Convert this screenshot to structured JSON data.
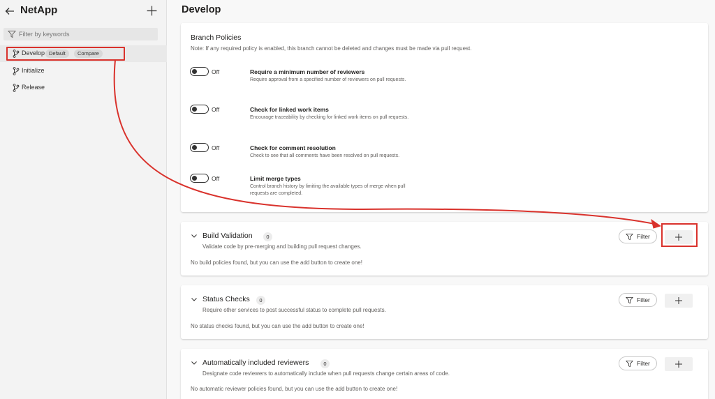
{
  "sidebar": {
    "title": "NetApp",
    "filter_placeholder": "Filter by keywords",
    "branches": [
      {
        "label": "Develop",
        "badges": [
          "Default",
          "Compare"
        ],
        "selected": true
      },
      {
        "label": "Initialize"
      },
      {
        "label": "Release"
      }
    ]
  },
  "main": {
    "title": "Develop",
    "branch_policies": {
      "title": "Branch Policies",
      "note": "Note: If any required policy is enabled, this branch cannot be deleted and changes must be made via pull request.",
      "policies": [
        {
          "state": "Off",
          "name": "Require a minimum number of reviewers",
          "desc": "Require approval from a specified number of reviewers on pull requests."
        },
        {
          "state": "Off",
          "name": "Check for linked work items",
          "desc": "Encourage traceability by checking for linked work items on pull requests."
        },
        {
          "state": "Off",
          "name": "Check for comment resolution",
          "desc": "Check to see that all comments have been resolved on pull requests."
        },
        {
          "state": "Off",
          "name": "Limit merge types",
          "desc": "Control branch history by limiting the available types of merge when pull requests are completed."
        }
      ]
    },
    "sections": [
      {
        "title": "Build Validation",
        "count": "0",
        "desc": "Validate code by pre-merging and building pull request changes.",
        "empty": "No build policies found, but you can use the add button to create one!",
        "filter_label": "Filter"
      },
      {
        "title": "Status Checks",
        "count": "0",
        "desc": "Require other services to post successful status to complete pull requests.",
        "empty": "No status checks found, but you can use the add button to create one!",
        "filter_label": "Filter"
      },
      {
        "title": "Automatically included reviewers",
        "count": "0",
        "desc": "Designate code reviewers to automatically include when pull requests change certain areas of code.",
        "empty": "No automatic reviewer policies found, but you can use the add button to create one!",
        "filter_label": "Filter"
      }
    ]
  },
  "annotation": {
    "color": "#d9322c"
  }
}
